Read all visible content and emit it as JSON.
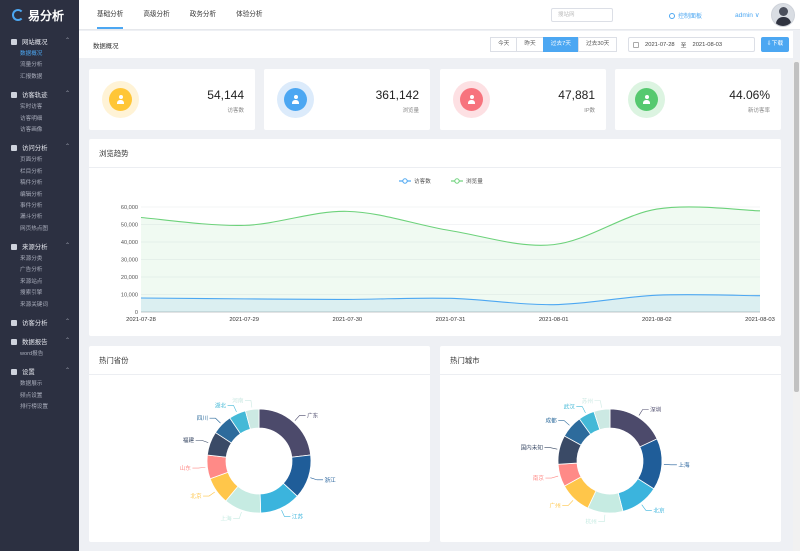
{
  "app": {
    "logo_text": "易分析"
  },
  "sidebar": {
    "groups": [
      {
        "title": "网站概况",
        "items": [
          "数据概况",
          "流量分析",
          "汇报数据"
        ]
      },
      {
        "title": "访客轨迹",
        "items": [
          "实时访客",
          "访客明细",
          "访客画像"
        ]
      },
      {
        "title": "访问分析",
        "items": [
          "页面分析",
          "栏目分析",
          "稿件分析",
          "编辑分析",
          "事件分析",
          "漏斗分析",
          "网页热点图"
        ]
      },
      {
        "title": "来源分析",
        "items": [
          "来源分类",
          "广告分析",
          "来源站点",
          "搜索引擎",
          "来源关键词"
        ]
      },
      {
        "title": "访客分析",
        "items": []
      },
      {
        "title": "数据报告",
        "items": [
          "word报告"
        ]
      },
      {
        "title": "设置",
        "items": [
          "数据展示",
          "频点设置",
          "排行榜设置"
        ]
      }
    ],
    "active_item": "数据概况"
  },
  "topbar": {
    "tabs": [
      "基础分析",
      "高级分析",
      "政务分析",
      "体验分析"
    ],
    "active_tab": "基础分析",
    "search_placeholder": "搜站网",
    "control_panel_label": "控制面板",
    "user_label": "admin ∨"
  },
  "subbar": {
    "breadcrumb": "数据概况",
    "range_buttons": [
      "今天",
      "昨天",
      "过去7天",
      "过去30天"
    ],
    "active_range": "过去7天",
    "date_start": "2021-07-28",
    "date_sep": "至",
    "date_end": "2021-08-03",
    "download_label": "⇩下载"
  },
  "stats": [
    {
      "value": "54,144",
      "label": "访客数",
      "color": "#ffc637",
      "ring": "#fff3d6"
    },
    {
      "value": "361,142",
      "label": "浏览量",
      "color": "#4ca7f2",
      "ring": "#dcebfb"
    },
    {
      "value": "47,881",
      "label": "IP数",
      "color": "#f7737d",
      "ring": "#fde0e3"
    },
    {
      "value": "44.06%",
      "label": "新访客率",
      "color": "#56c96f",
      "ring": "#dcf4e1"
    }
  ],
  "trend_panel": {
    "title": "浏览趋势"
  },
  "province_panel": {
    "title": "热门省份"
  },
  "city_panel": {
    "title": "热门城市"
  },
  "chart_data": [
    {
      "type": "line",
      "x": [
        "2021-07-28",
        "2021-07-29",
        "2021-07-30",
        "2021-07-31",
        "2021-08-01",
        "2021-08-02",
        "2021-08-03"
      ],
      "series": [
        {
          "name": "访客数",
          "values": [
            8000,
            7500,
            7200,
            7800,
            4200,
            9600,
            9300
          ],
          "color": "#4ca7f2"
        },
        {
          "name": "浏览量",
          "values": [
            54000,
            49500,
            57500,
            46500,
            38500,
            58800,
            57800
          ],
          "color": "#6dd27b"
        }
      ],
      "yticks": [
        "0",
        "10,000",
        "20,000",
        "30,000",
        "40,000",
        "50,000",
        "60,000"
      ],
      "ylim": [
        0,
        60000
      ],
      "legend": "top-center",
      "grid": true
    },
    {
      "type": "pie",
      "subtype": "donut",
      "labels": [
        "广东",
        "浙江",
        "江苏",
        "上海",
        "北京",
        "山东",
        "福建",
        "四川",
        "湖北",
        "河南"
      ],
      "values": [
        22,
        13,
        12,
        11,
        8,
        7,
        7,
        6,
        5,
        4
      ],
      "colors": [
        "#4c4a6b",
        "#1f5d99",
        "#3bb4dd",
        "#c6ebe2",
        "#ffc64a",
        "#ff8a87",
        "#3a4a66",
        "#2d6b9c",
        "#44b9d7",
        "#cce9e3"
      ]
    },
    {
      "type": "pie",
      "subtype": "donut",
      "labels": [
        "深圳",
        "上海",
        "北京",
        "杭州",
        "广州",
        "南京",
        "国内未知",
        "成都",
        "武汉",
        "苏州"
      ],
      "values": [
        18,
        16,
        12,
        11,
        10,
        7,
        9,
        7,
        5,
        5
      ],
      "colors": [
        "#4c4a6b",
        "#1f5d99",
        "#3bb4dd",
        "#c6ebe2",
        "#ffc64a",
        "#ff8a87",
        "#3a4a66",
        "#2d6b9c",
        "#44b9d7",
        "#cce9e3"
      ]
    }
  ]
}
